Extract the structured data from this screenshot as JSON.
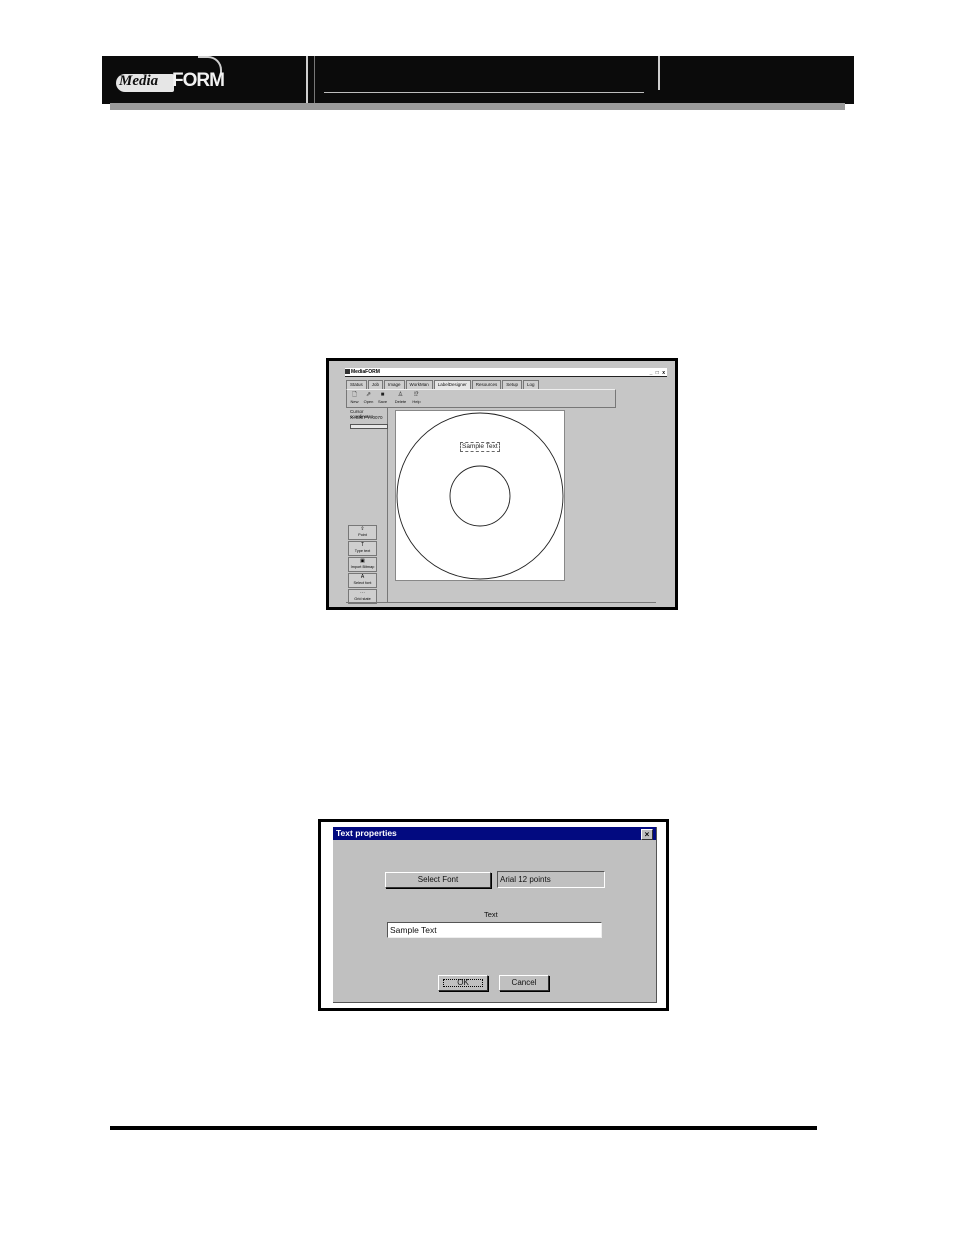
{
  "header": {
    "logo_media": "Media",
    "logo_form": "FORM"
  },
  "figure1": {
    "window_title": "MediaFORM",
    "window_controls": "_ □ x",
    "tabs": [
      {
        "label": "Status"
      },
      {
        "label": "Job"
      },
      {
        "label": "Image"
      },
      {
        "label": "WorkMan"
      },
      {
        "label": "LabelDesigner",
        "active": true
      },
      {
        "label": "Resources"
      },
      {
        "label": "Setup"
      },
      {
        "label": "Log"
      }
    ],
    "toolbar": [
      {
        "label": "New",
        "icon": "new-document-icon"
      },
      {
        "label": "Open",
        "icon": "open-folder-icon"
      },
      {
        "label": "Save",
        "icon": "save-disk-icon"
      },
      {
        "label": "Delete",
        "icon": "delete-icon"
      },
      {
        "label": "Help",
        "icon": "help-icon"
      }
    ],
    "cursor_label": "Cursor coordinates",
    "cursor_value": "X=0007 Y=0070",
    "tools": [
      {
        "label": "Point",
        "icon": "pointer-icon"
      },
      {
        "label": "Type text",
        "icon": "text-tool-icon"
      },
      {
        "label": "Import Bitmap",
        "icon": "bitmap-icon"
      },
      {
        "label": "Select font",
        "icon": "font-icon"
      },
      {
        "label": "Grid state",
        "icon": "grid-icon"
      }
    ],
    "canvas_text": "Sample Text"
  },
  "figure2": {
    "title": "Text properties",
    "close_glyph": "×",
    "select_font_label": "Select Font",
    "font_value": "Arial 12 points",
    "text_label": "Text",
    "text_value": "Sample Text",
    "ok_label": "OK",
    "cancel_label": "Cancel"
  }
}
